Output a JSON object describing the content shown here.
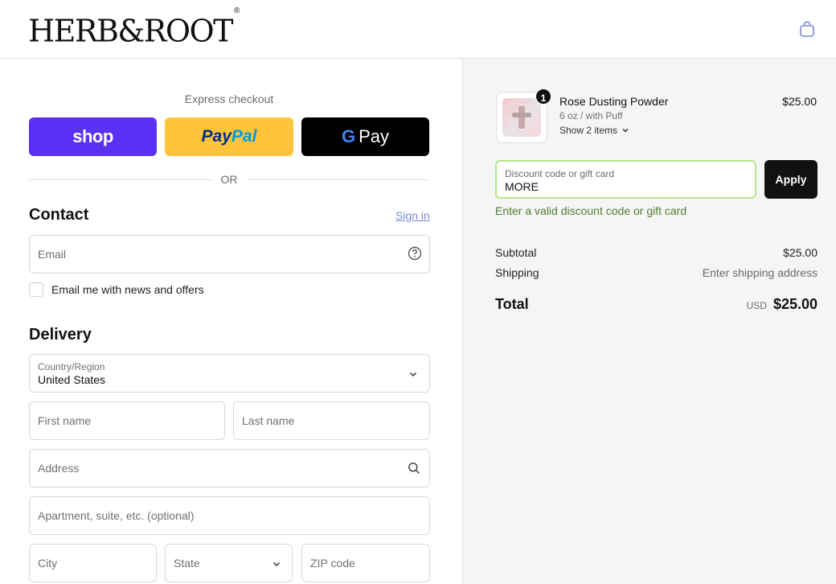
{
  "header": {
    "logo_text": "HERB&ROOT",
    "logo_mark": "®",
    "cart_icon": "shopping-bag-icon"
  },
  "express": {
    "label": "Express checkout",
    "shop_label": "shop",
    "paypal_part1": "Pay",
    "paypal_part2": "Pal",
    "gpay_g": "G",
    "gpay_label": "Pay",
    "or_label": "OR"
  },
  "contact": {
    "title": "Contact",
    "sign_in": "Sign in",
    "email_placeholder": "Email",
    "news_label": "Email me with news and offers"
  },
  "delivery": {
    "title": "Delivery",
    "country_label": "Country/Region",
    "country_value": "United States",
    "first_name_placeholder": "First name",
    "last_name_placeholder": "Last name",
    "address_placeholder": "Address",
    "apartment_placeholder": "Apartment, suite, etc. (optional)",
    "city_placeholder": "City",
    "state_placeholder": "State",
    "zip_placeholder": "ZIP code"
  },
  "summary": {
    "product": {
      "quantity": "1",
      "name": "Rose Dusting Powder",
      "variant": "6 oz / with Puff",
      "show_items": "Show 2 items",
      "price": "$25.00"
    },
    "discount_label": "Discount code or gift card",
    "discount_value": "MORE",
    "apply_label": "Apply",
    "discount_error": "Enter a valid discount code or gift card",
    "subtotal_label": "Subtotal",
    "subtotal_value": "$25.00",
    "shipping_label": "Shipping",
    "shipping_value": "Enter shipping address",
    "total_label": "Total",
    "currency": "USD",
    "total_value": "$25.00"
  },
  "colors": {
    "shop_purple": "#5a31f4",
    "paypal_yellow": "#ffc439",
    "discount_border": "#b5e68c",
    "discount_error": "#4f7d2e"
  }
}
